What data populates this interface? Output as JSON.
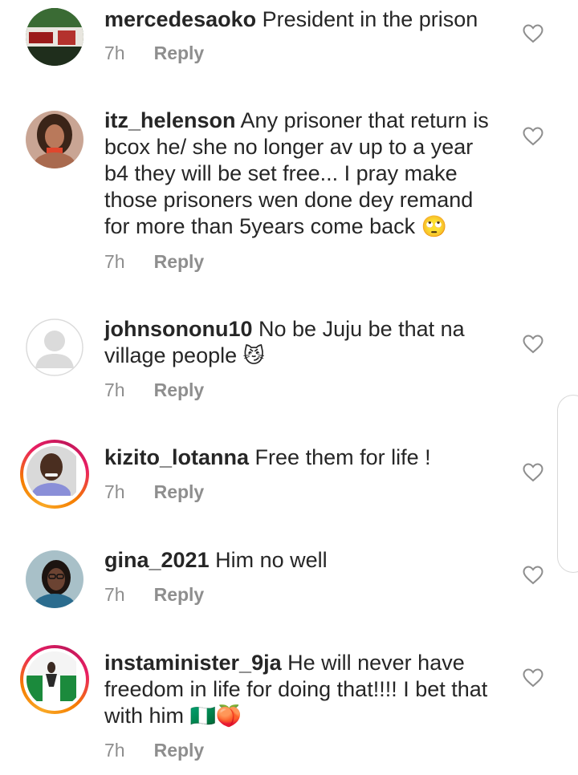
{
  "colors": {
    "text": "#262626",
    "meta": "#8e8e8e",
    "story_ring": "#e91e63"
  },
  "reply_label": "Reply",
  "comments": [
    {
      "username": "mercedesaoko",
      "text": "President in the prison",
      "time": "7h",
      "emoji": ""
    },
    {
      "username": "itz_helenson",
      "text": "Any prisoner that return is bcox he/ she no longer av up to a year b4 they will be set free... I pray make those prisoners wen done dey remand for more than 5years come back",
      "time": "7h",
      "emoji": "🙄"
    },
    {
      "username": "johnsononu10",
      "text": "No be Juju be that na village people",
      "time": "7h",
      "emoji": "😼"
    },
    {
      "username": "kizito_lotanna",
      "text": "Free them for life !",
      "time": "7h",
      "emoji": ""
    },
    {
      "username": "gina_2021",
      "text": "Him no well",
      "time": "7h",
      "emoji": ""
    },
    {
      "username": "instaminister_9ja",
      "text": "He will never have freedom in life for doing that!!!! I bet that with him",
      "time": "7h",
      "emoji": "🇳🇬🍑"
    }
  ]
}
